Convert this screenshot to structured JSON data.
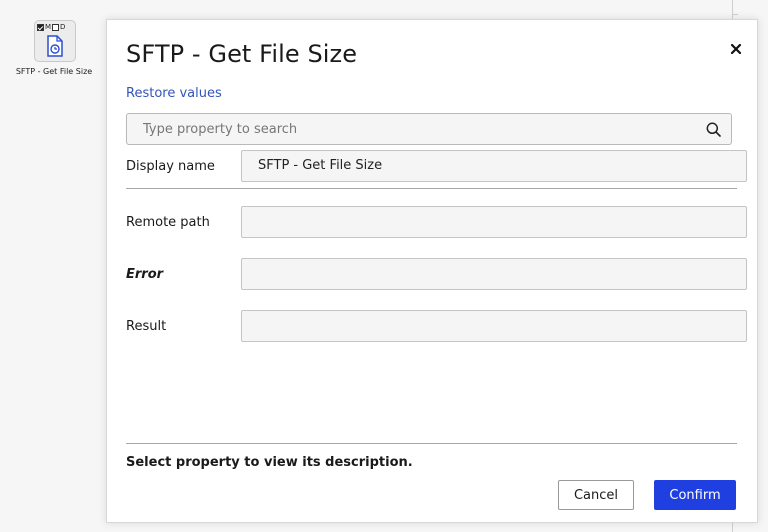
{
  "node": {
    "flag_m": "M",
    "flag_d": "D",
    "label": "SFTP - Get File Size",
    "icon": "file-clock-icon"
  },
  "dialog": {
    "title": "SFTP - Get File Size",
    "restore_label": "Restore values",
    "search_placeholder": "Type property to search",
    "display_name_label": "Display name",
    "display_name_value": "SFTP - Get File Size",
    "properties": [
      {
        "label": "Remote path",
        "value": ""
      },
      {
        "label": "Error",
        "value": ""
      },
      {
        "label": "Result",
        "value": ""
      }
    ],
    "description": "Select property to view its description.",
    "cancel_label": "Cancel",
    "confirm_label": "Confirm"
  },
  "colors": {
    "accent": "#1f3fe0",
    "link": "#3355bb"
  }
}
